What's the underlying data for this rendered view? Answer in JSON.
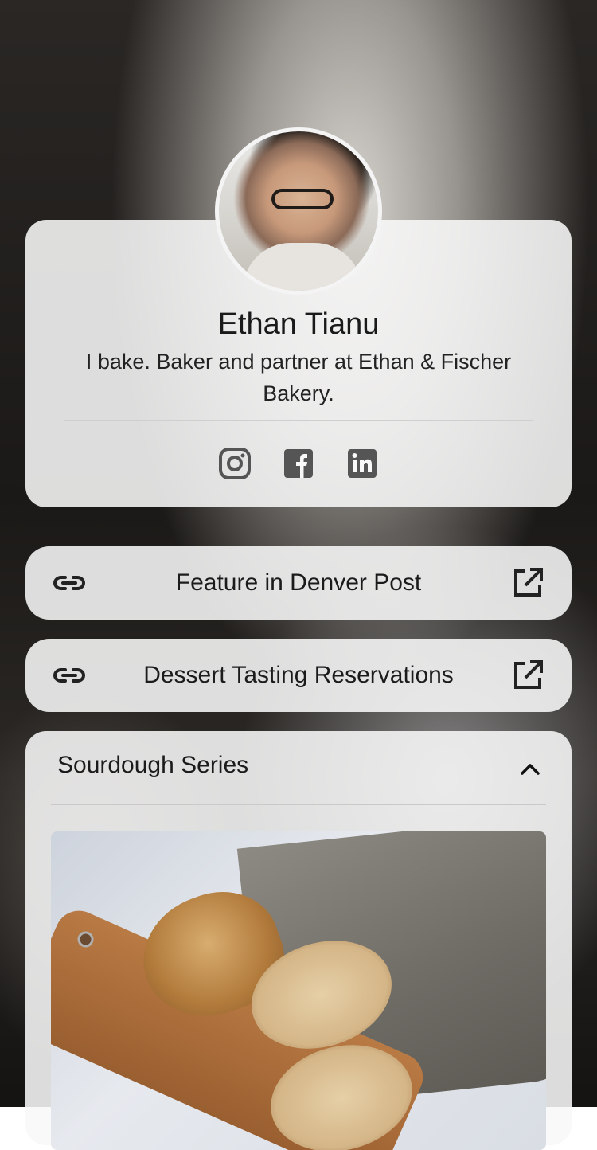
{
  "profile": {
    "name": "Ethan Tianu",
    "bio": "I bake. Baker and partner at Ethan & Fischer Bakery.",
    "socials": [
      "instagram-icon",
      "facebook-icon",
      "linkedin-icon"
    ]
  },
  "links": [
    {
      "label": "Feature in Denver Post",
      "icon": "link-icon",
      "action_icon": "external-link-icon"
    },
    {
      "label": "Dessert Tasting Reservations",
      "icon": "link-icon",
      "action_icon": "external-link-icon"
    }
  ],
  "section": {
    "title": "Sourdough Series",
    "toggle_icon": "chevron-up-icon"
  },
  "colors": {
    "card_bg": "#f8f8f8",
    "icon": "#555555",
    "text": "#1b1b1b"
  }
}
